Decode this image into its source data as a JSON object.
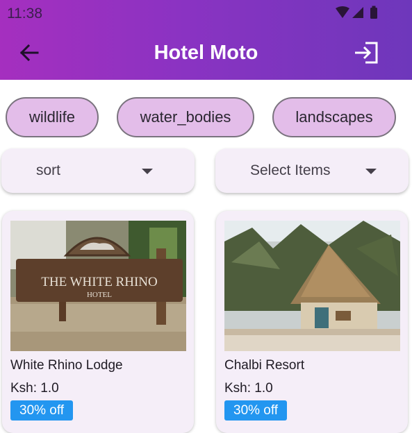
{
  "status_bar": {
    "time": "11:38"
  },
  "app_bar": {
    "title": "Hotel Moto",
    "back_icon": "arrow-left-icon",
    "logout_icon": "login-icon"
  },
  "chips": [
    {
      "label": "wildlife"
    },
    {
      "label": "water_bodies"
    },
    {
      "label": "landscapes"
    }
  ],
  "filters": {
    "sort": {
      "value": "sort"
    },
    "items": {
      "value": "Select Items"
    }
  },
  "hotels": [
    {
      "name": "White Rhino Lodge",
      "price": "Ksh: 1.0",
      "discount": "30% off",
      "sign_text": "THE WHITE RHINO",
      "sign_subtext": "HOTEL"
    },
    {
      "name": "Chalbi Resort",
      "price": "Ksh: 1.0",
      "discount": "30% off"
    }
  ],
  "colors": {
    "appbar_start": "#a52fbf",
    "appbar_end": "#6e37bb",
    "chip_bg": "#e3bde9",
    "badge": "#2396f0",
    "card_bg": "#f5eef8"
  }
}
